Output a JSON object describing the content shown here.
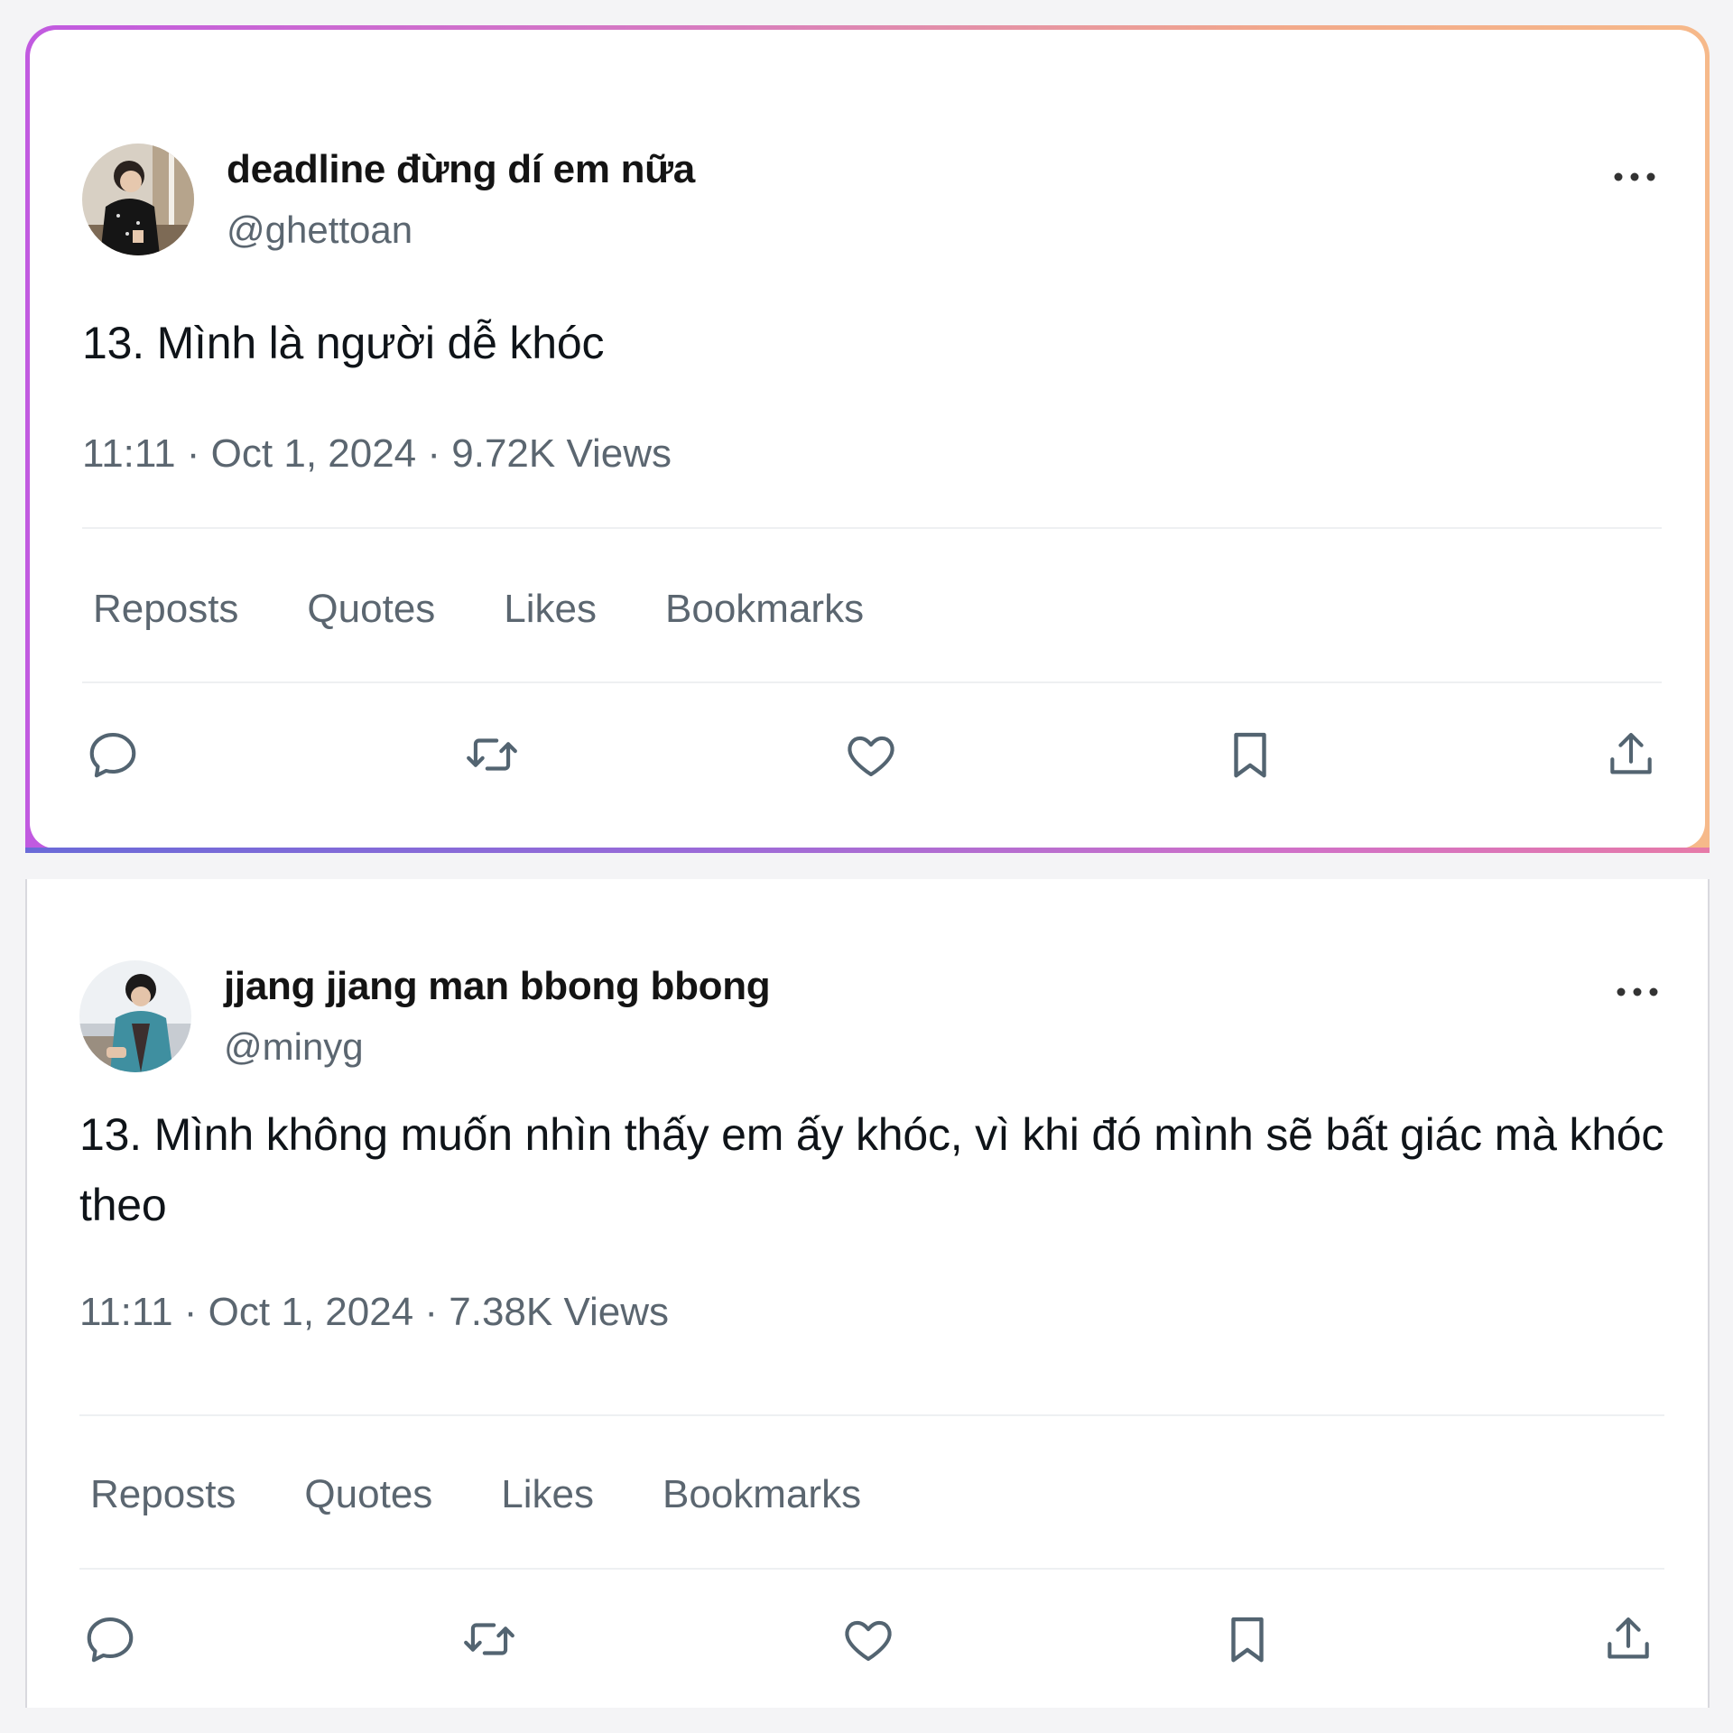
{
  "tweets": [
    {
      "display_name": "deadline đừng dí em nữa",
      "handle": "@ghettoan",
      "text": "13. Mình là người dễ khóc",
      "meta": "11:11 · Oct 1, 2024 · 9.72K Views",
      "stats": {
        "reposts": "Reposts",
        "quotes": "Quotes",
        "likes": "Likes",
        "bookmarks": "Bookmarks"
      },
      "avatar_icon": "user-photo-avatar",
      "more_icon": "more-dots-icon"
    },
    {
      "display_name": "jjang jjang man bbong bbong",
      "handle": "@minyg",
      "text": "13. Mình không muốn nhìn thấy em ấy khóc, vì khi đó mình sẽ bất giác mà khóc theo",
      "meta": "11:11 · Oct 1, 2024 · 7.38K Views",
      "stats": {
        "reposts": "Reposts",
        "quotes": "Quotes",
        "likes": "Likes",
        "bookmarks": "Bookmarks"
      },
      "avatar_icon": "user-photo-avatar",
      "more_icon": "more-dots-icon"
    }
  ],
  "action_icons": [
    "reply-icon",
    "retweet-icon",
    "like-icon",
    "bookmark-icon",
    "share-icon"
  ],
  "colors": {
    "text_primary": "#0f1419",
    "text_secondary": "#5b6670",
    "icon": "#536471",
    "border_gradient_start": "#c15ae0",
    "border_gradient_end": "#f6b98a"
  }
}
